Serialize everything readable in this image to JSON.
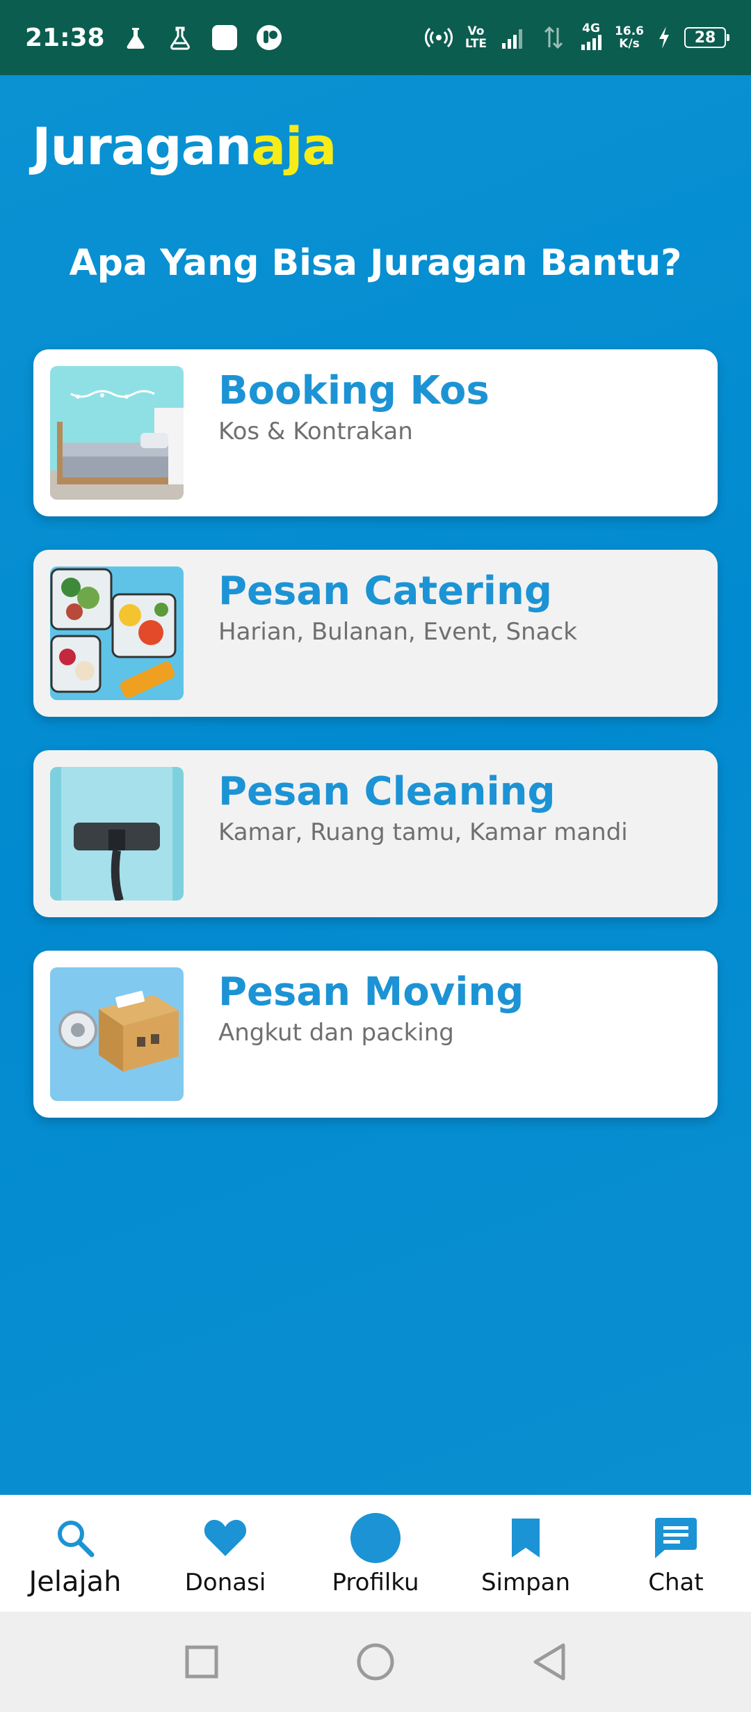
{
  "status_bar": {
    "time": "21:38",
    "volte_top": "Vo",
    "volte_bottom": "LTE",
    "net_gen": "4G",
    "speed_value": "16.6",
    "speed_unit": "K/s",
    "battery": "28"
  },
  "header": {
    "brand_part1": "Juragan",
    "brand_part2": "aja",
    "headline": "Apa Yang Bisa Juragan Bantu?"
  },
  "services": [
    {
      "title": "Booking Kos",
      "subtitle": "Kos & Kontrakan",
      "image_icon": "bedroom-image"
    },
    {
      "title": "Pesan Catering",
      "subtitle": "Harian, Bulanan, Event, Snack",
      "image_icon": "food-containers-image"
    },
    {
      "title": "Pesan Cleaning",
      "subtitle": "Kamar, Ruang tamu, Kamar mandi",
      "image_icon": "vacuum-image"
    },
    {
      "title": "Pesan Moving",
      "subtitle": "Angkut dan packing",
      "image_icon": "flying-box-image"
    }
  ],
  "bottom_nav": [
    {
      "label": "Jelajah",
      "icon": "search-icon",
      "active": true
    },
    {
      "label": "Donasi",
      "icon": "heart-icon",
      "active": false
    },
    {
      "label": "Profilku",
      "icon": "avatar-icon",
      "active": false
    },
    {
      "label": "Simpan",
      "icon": "bookmark-icon",
      "active": false
    },
    {
      "label": "Chat",
      "icon": "chat-icon",
      "active": false
    }
  ],
  "colors": {
    "status_bar": "#0b5d4f",
    "background": "#0a8fd0",
    "accent": "#1c93d4",
    "brand_yellow": "#f7ec18"
  }
}
